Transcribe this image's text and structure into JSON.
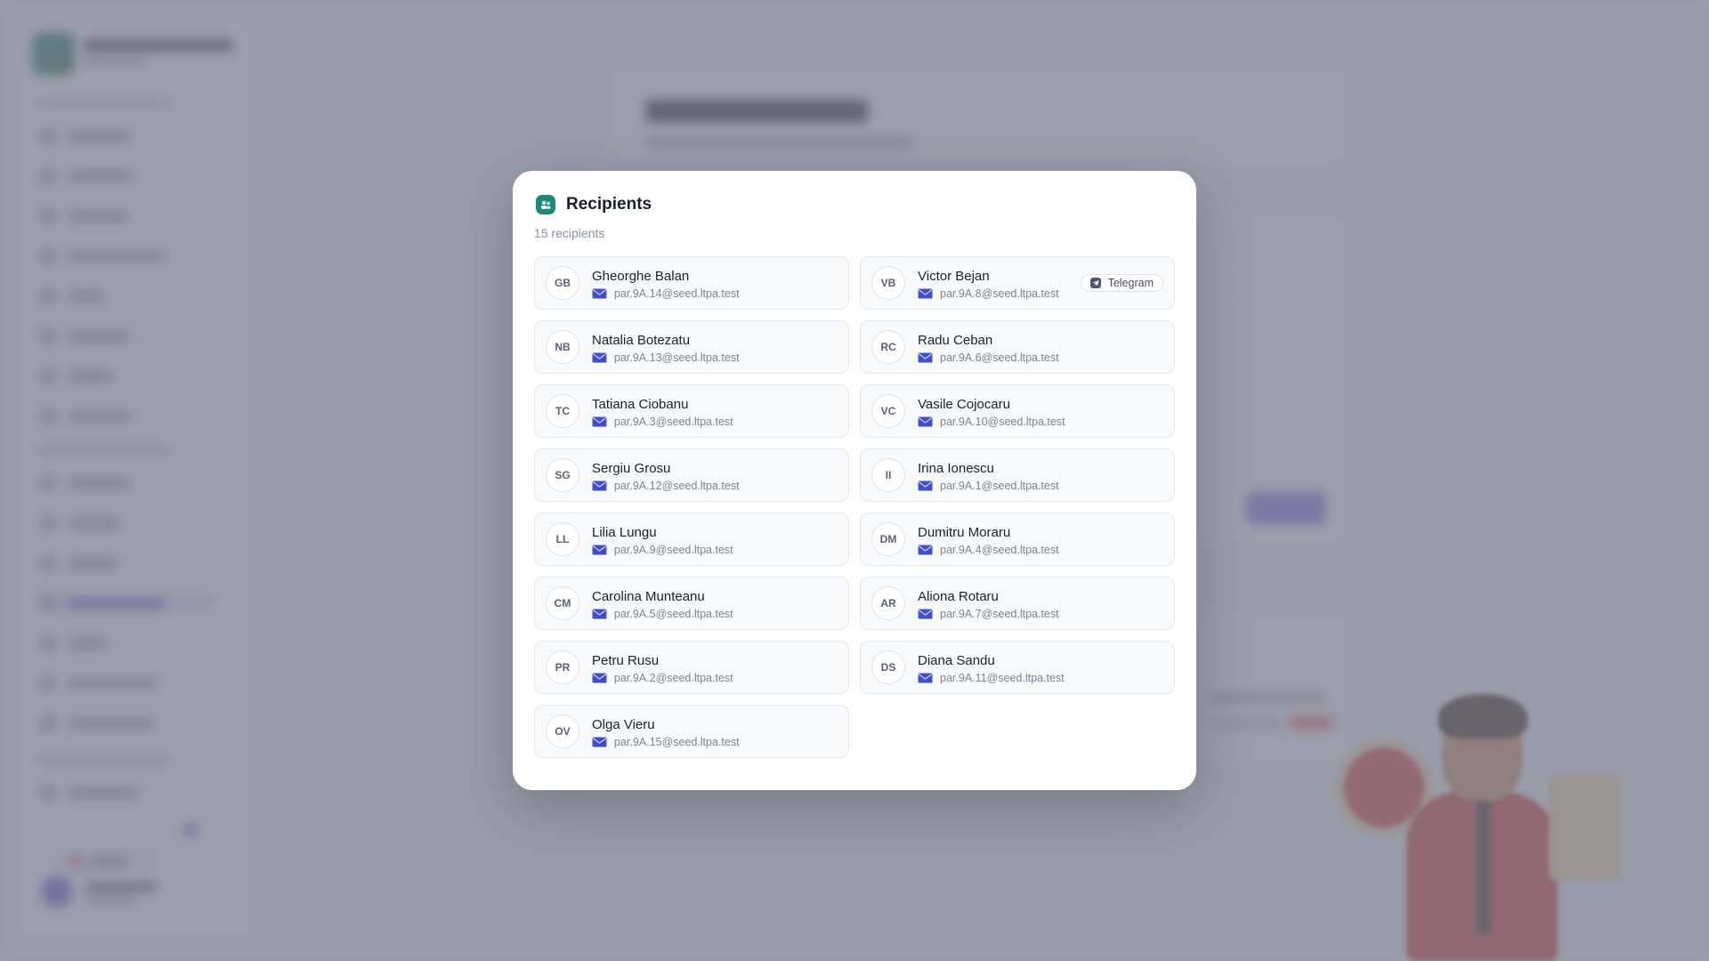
{
  "modal": {
    "title": "Recipients",
    "icon": "recipients-icon",
    "count_label": "15 recipients"
  },
  "recipients": [
    {
      "initials": "GB",
      "name": "Gheorghe Balan",
      "email": "par.9A.14@seed.ltpa.test",
      "badge": null
    },
    {
      "initials": "VB",
      "name": "Victor Bejan",
      "email": "par.9A.8@seed.ltpa.test",
      "badge": "Telegram"
    },
    {
      "initials": "NB",
      "name": "Natalia Botezatu",
      "email": "par.9A.13@seed.ltpa.test",
      "badge": null
    },
    {
      "initials": "RC",
      "name": "Radu Ceban",
      "email": "par.9A.6@seed.ltpa.test",
      "badge": null
    },
    {
      "initials": "TC",
      "name": "Tatiana Ciobanu",
      "email": "par.9A.3@seed.ltpa.test",
      "badge": null
    },
    {
      "initials": "VC",
      "name": "Vasile Cojocaru",
      "email": "par.9A.10@seed.ltpa.test",
      "badge": null
    },
    {
      "initials": "SG",
      "name": "Sergiu Grosu",
      "email": "par.9A.12@seed.ltpa.test",
      "badge": null
    },
    {
      "initials": "II",
      "name": "Irina Ionescu",
      "email": "par.9A.1@seed.ltpa.test",
      "badge": null
    },
    {
      "initials": "LL",
      "name": "Lilia Lungu",
      "email": "par.9A.9@seed.ltpa.test",
      "badge": null
    },
    {
      "initials": "DM",
      "name": "Dumitru Moraru",
      "email": "par.9A.4@seed.ltpa.test",
      "badge": null
    },
    {
      "initials": "CM",
      "name": "Carolina Munteanu",
      "email": "par.9A.5@seed.ltpa.test",
      "badge": null
    },
    {
      "initials": "AR",
      "name": "Aliona Rotaru",
      "email": "par.9A.7@seed.ltpa.test",
      "badge": null
    },
    {
      "initials": "PR",
      "name": "Petru Rusu",
      "email": "par.9A.2@seed.ltpa.test",
      "badge": null
    },
    {
      "initials": "DS",
      "name": "Diana Sandu",
      "email": "par.9A.11@seed.ltpa.test",
      "badge": null
    },
    {
      "initials": "OV",
      "name": "Olga Vieru",
      "email": "par.9A.15@seed.ltpa.test",
      "badge": null
    }
  ],
  "colors": {
    "accent": "#1d8a79",
    "mail_icon": "#3f4fc9",
    "background_active": "#5a56c9"
  }
}
